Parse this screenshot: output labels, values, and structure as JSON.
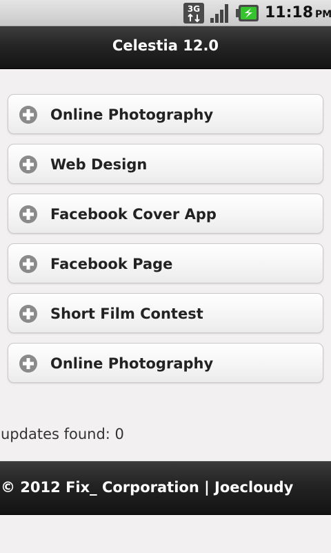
{
  "status_bar": {
    "network_label": "3G",
    "time": "11:18",
    "ampm": "PM"
  },
  "header": {
    "title": "Celestia 12.0"
  },
  "list": {
    "items": [
      {
        "label": "Online Photography"
      },
      {
        "label": "Web Design"
      },
      {
        "label": "Facebook Cover App"
      },
      {
        "label": "Facebook Page"
      },
      {
        "label": "Short Film Contest"
      },
      {
        "label": "Online Photography"
      }
    ]
  },
  "updates_text": "updates found: 0",
  "footer": {
    "text": "© 2012 Fix_ Corporation | Joecloudy"
  },
  "colors": {
    "header_bg": "#1c1c1c",
    "icon_gray": "#8a8a8a",
    "battery_green": "#35c42d"
  }
}
